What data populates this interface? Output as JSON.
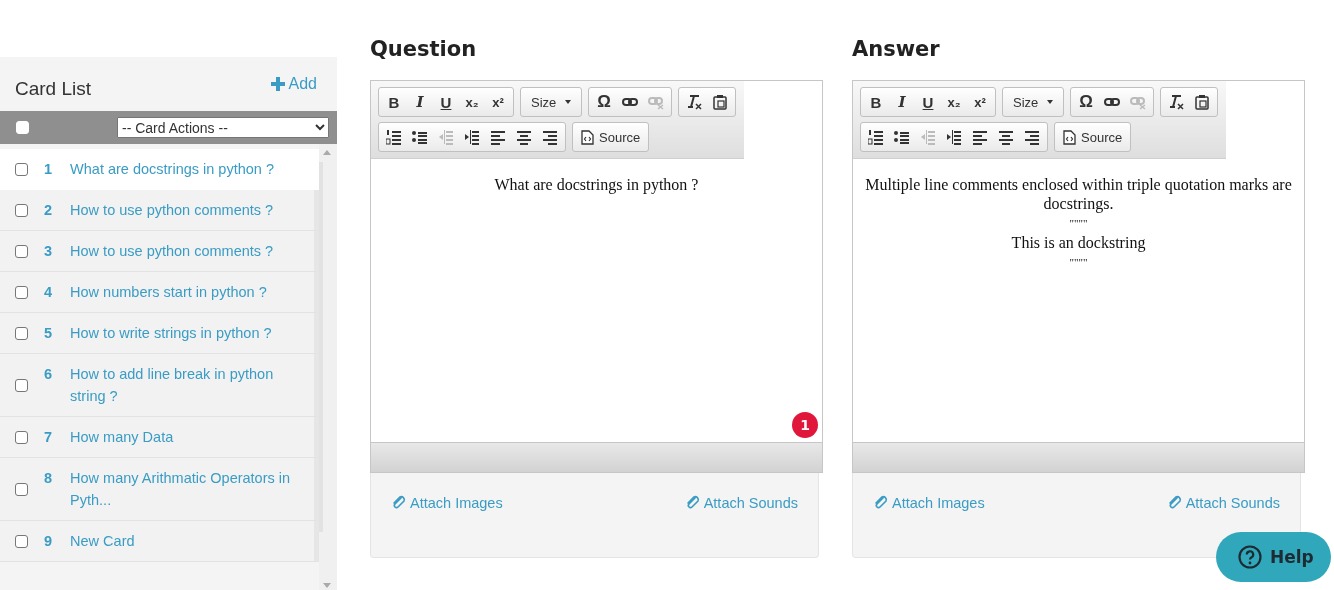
{
  "sidebar": {
    "title": "Card List",
    "add_button": "Add",
    "bulk_select": {
      "checked": false
    },
    "actions_dropdown": "-- Card Actions --",
    "cards": [
      {
        "number": "1",
        "title": "What are docstrings in python ?",
        "checked": false,
        "selected": true
      },
      {
        "number": "2",
        "title": "How to use python comments ?",
        "checked": false,
        "selected": false
      },
      {
        "number": "3",
        "title": "How to use python comments ?",
        "checked": false,
        "selected": false
      },
      {
        "number": "4",
        "title": "How numbers start in python ?",
        "checked": false,
        "selected": false
      },
      {
        "number": "5",
        "title": "How to write strings in python ?",
        "checked": false,
        "selected": false
      },
      {
        "number": "6",
        "title": "How to add line break in python string ?",
        "checked": false,
        "selected": false
      },
      {
        "number": "7",
        "title": "How many Data",
        "checked": false,
        "selected": false
      },
      {
        "number": "8",
        "title": "How many Arithmatic Operators in Pyth...",
        "checked": false,
        "selected": false
      },
      {
        "number": "9",
        "title": "New Card",
        "checked": false,
        "selected": false
      }
    ]
  },
  "editors": [
    {
      "heading": "Question",
      "toolbar": [
        [
          {
            "kind": "bold",
            "label": "B",
            "disabled": false
          },
          {
            "kind": "italic",
            "label": "I",
            "disabled": false
          },
          {
            "kind": "underline",
            "label": "U",
            "disabled": false
          },
          {
            "kind": "subscript",
            "label": "x₂",
            "disabled": false
          },
          {
            "kind": "superscript",
            "label": "x²",
            "disabled": false
          }
        ],
        [
          {
            "kind": "size",
            "label": "Size",
            "disabled": false
          }
        ],
        [
          {
            "kind": "symbol",
            "label": "Ω",
            "disabled": false
          },
          {
            "kind": "link",
            "disabled": false
          },
          {
            "kind": "unlink",
            "disabled": true
          }
        ],
        [
          {
            "kind": "clear-format",
            "disabled": false
          },
          {
            "kind": "paste-word",
            "disabled": false
          }
        ],
        [
          {
            "kind": "numbered-list",
            "disabled": false
          },
          {
            "kind": "bullet-list",
            "disabled": false
          },
          {
            "kind": "outdent",
            "disabled": true
          },
          {
            "kind": "indent",
            "disabled": false
          },
          {
            "kind": "align-left",
            "disabled": false
          },
          {
            "kind": "align-center",
            "disabled": false
          },
          {
            "kind": "align-right",
            "disabled": false
          }
        ],
        [
          {
            "kind": "source",
            "label": "Source",
            "disabled": false
          }
        ]
      ],
      "content": [
        "What are docstrings in python ?"
      ],
      "notice_count": "1",
      "attach_images": "Attach Images",
      "attach_sounds": "Attach Sounds"
    },
    {
      "heading": "Answer",
      "toolbar": [
        [
          {
            "kind": "bold",
            "label": "B",
            "disabled": false
          },
          {
            "kind": "italic",
            "label": "I",
            "disabled": false
          },
          {
            "kind": "underline",
            "label": "U",
            "disabled": false
          },
          {
            "kind": "subscript",
            "label": "x₂",
            "disabled": false
          },
          {
            "kind": "superscript",
            "label": "x²",
            "disabled": false
          }
        ],
        [
          {
            "kind": "size",
            "label": "Size",
            "disabled": false
          }
        ],
        [
          {
            "kind": "symbol",
            "label": "Ω",
            "disabled": false
          },
          {
            "kind": "link",
            "disabled": false
          },
          {
            "kind": "unlink",
            "disabled": true
          }
        ],
        [
          {
            "kind": "clear-format",
            "disabled": false
          },
          {
            "kind": "paste-word",
            "disabled": false
          }
        ],
        [
          {
            "kind": "numbered-list",
            "disabled": false
          },
          {
            "kind": "bullet-list",
            "disabled": false
          },
          {
            "kind": "outdent",
            "disabled": true
          },
          {
            "kind": "indent",
            "disabled": false
          },
          {
            "kind": "align-left",
            "disabled": false
          },
          {
            "kind": "align-center",
            "disabled": false
          },
          {
            "kind": "align-right",
            "disabled": false
          }
        ],
        [
          {
            "kind": "source",
            "label": "Source",
            "disabled": false
          }
        ]
      ],
      "content": [
        "Multiple line comments enclosed within triple quotation marks are docstrings.",
        "\"\"\"\"",
        "This is an dockstring",
        "\"\"\"\""
      ],
      "attach_images": "Attach Images",
      "attach_sounds": "Attach Sounds"
    }
  ],
  "help_button": "Help"
}
